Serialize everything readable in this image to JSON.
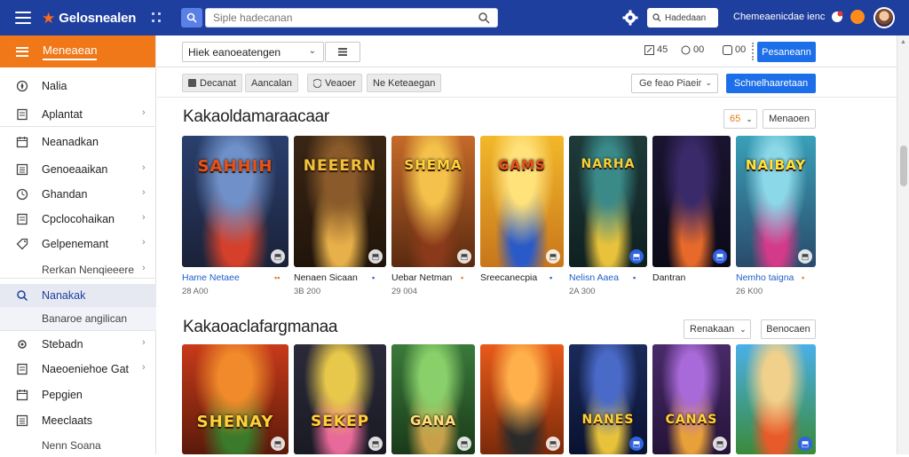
{
  "topbar": {
    "app_name": "Gelosnealen",
    "search_placeholder": "Siple hadecanan",
    "search2_label": "Hadedaan",
    "user_name": "Chemeaenicdae ienc"
  },
  "sidebar": {
    "header_label": "Meneaean",
    "items": [
      {
        "label": "Nalia",
        "icon": "compass-icon",
        "chevron": false
      },
      {
        "label": "Aplantat",
        "icon": "page-icon",
        "chevron": true
      },
      {
        "label": "Neanadkan",
        "icon": "calendar-icon",
        "chevron": false
      },
      {
        "label": "Genoeaaikan",
        "icon": "list-icon",
        "chevron": true
      },
      {
        "label": "Ghandan",
        "icon": "clock-icon",
        "chevron": true
      },
      {
        "label": "Cpclocohaikan",
        "icon": "page-icon",
        "chevron": true
      },
      {
        "label": "Gelpenemant",
        "icon": "tag-icon",
        "chevron": true
      },
      {
        "label": "Rerkan Nenqieeere",
        "icon": "",
        "chevron": true
      },
      {
        "label": "Nanakak",
        "icon": "search-icon",
        "chevron": false
      },
      {
        "label": "Banaroe angilican",
        "icon": "",
        "chevron": false
      },
      {
        "label": "Stebadn",
        "icon": "settings-icon",
        "chevron": true
      },
      {
        "label": "Naeoeniehoe Gat",
        "icon": "page-icon",
        "chevron": true
      },
      {
        "label": "Pepgien",
        "icon": "calendar-icon",
        "chevron": false
      },
      {
        "label": "Meeclaats",
        "icon": "list-icon",
        "chevron": false
      },
      {
        "label": "Nenn Soana",
        "icon": "",
        "chevron": false
      }
    ]
  },
  "toolbar": {
    "select_value": "Hiek eanoeatengen",
    "icon_a_label": "45",
    "icon_b_label": "00",
    "icon_c_label": "00",
    "primary_button": "Pesaneann"
  },
  "filters": {
    "chips": [
      "Decanat",
      "Aancalan",
      "Veaoer",
      "Ne Keteaegan"
    ],
    "sort_label": "Ge feao Piaeir",
    "apply_label": "Schnelhaaretaan"
  },
  "sections": [
    {
      "title": "Kakaoldamaraacaar",
      "control_a": "65",
      "control_b": "Menaoen",
      "games": [
        {
          "caption": "Hame Netaee",
          "sub": "28 A00",
          "cap_icon": "▪▪",
          "art_title": "SAHHIH",
          "badge_blue": false
        },
        {
          "caption": "Nenaen Sicaan",
          "sub": "3B 200",
          "cap_icon": "▪",
          "art_title": "NEEERN",
          "badge_blue": false
        },
        {
          "caption": "Uebar Netman",
          "sub": "29 004",
          "cap_icon": "▪",
          "art_title": "SHEMA",
          "badge_blue": false
        },
        {
          "caption": "Sreecanecpia",
          "sub": "",
          "cap_icon": "▪",
          "art_title": "GAMS",
          "badge_blue": false
        },
        {
          "caption": "Nelisn Aaea",
          "sub": "2A 300",
          "cap_icon": "▪",
          "art_title": "NARHA",
          "badge_blue": true
        },
        {
          "caption": "Dantran",
          "sub": "",
          "cap_icon": "",
          "art_title": "",
          "badge_blue": true
        },
        {
          "caption": "Nemho taigna",
          "sub": "26 K00",
          "cap_icon": "▪",
          "art_title": "NAIBAY",
          "badge_blue": false
        }
      ]
    },
    {
      "title": "Kakaoaclafargmanaa",
      "control_a": "Renakaan",
      "control_b": "Benocaen",
      "games": [
        {
          "art_title": "SHENAY",
          "badge_blue": false
        },
        {
          "art_title": "SEKEP",
          "badge_blue": false
        },
        {
          "art_title": "GANA",
          "badge_blue": false
        },
        {
          "art_title": "",
          "badge_blue": false
        },
        {
          "art_title": "NANES",
          "badge_blue": true
        },
        {
          "art_title": "CANAS",
          "badge_blue": false
        },
        {
          "art_title": "",
          "badge_blue": true
        }
      ]
    }
  ],
  "colors": {
    "topbar": "#1f3f9e",
    "sidebar_header": "#f07818",
    "primary": "#1c6fe8"
  }
}
